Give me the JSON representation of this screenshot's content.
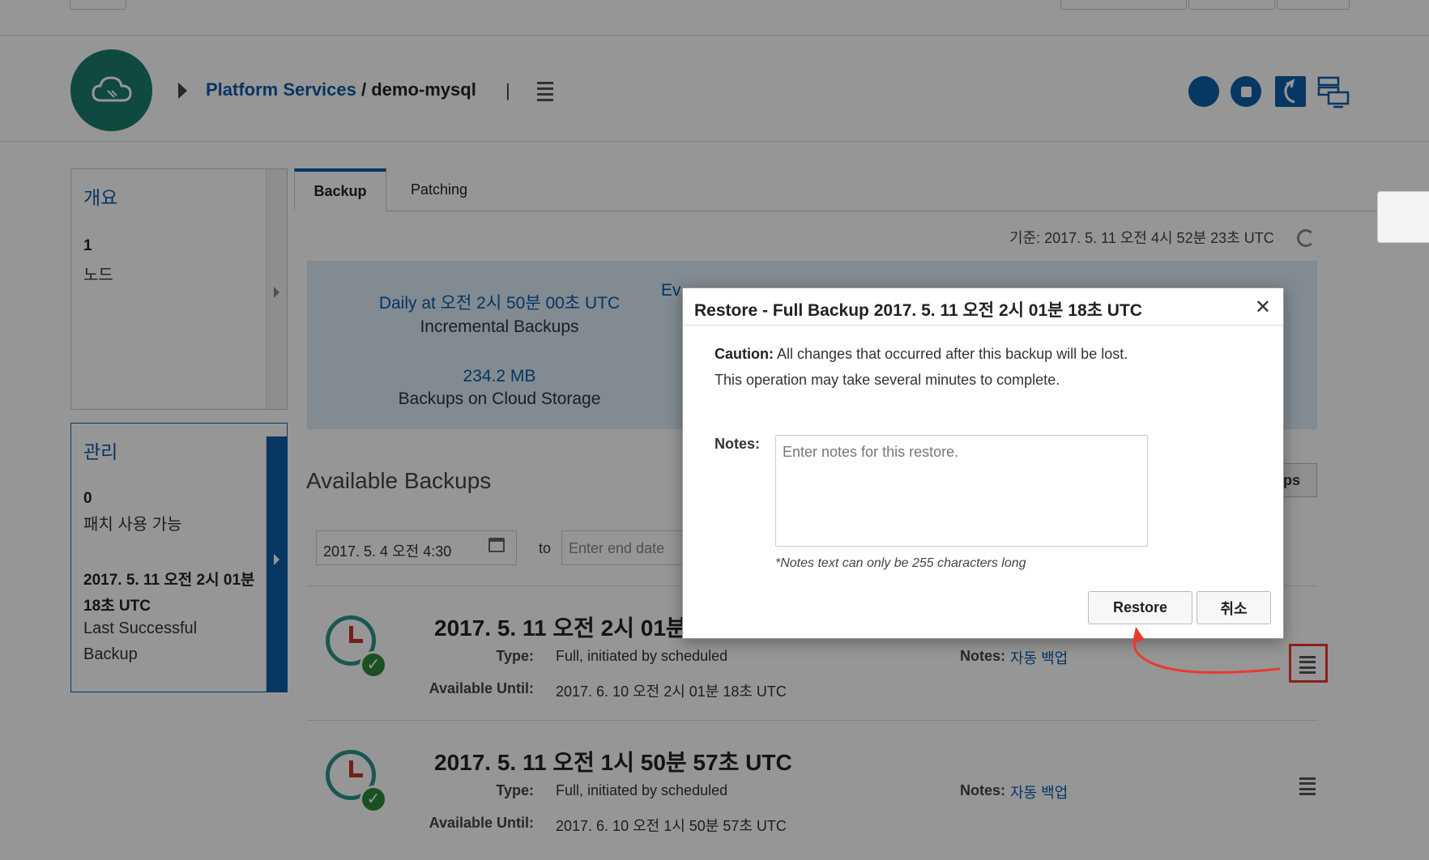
{
  "header": {
    "crumb_link": "Platform Services",
    "crumb_separator": " / ",
    "crumb_current": "demo-mysql",
    "crumb_bar": "|"
  },
  "sidebar": {
    "overview": {
      "title": "개요",
      "count": "1",
      "label": "노드"
    },
    "manage": {
      "title": "관리",
      "count": "0",
      "count_label": "패치 사용 가능",
      "last_backup_line1": "2017. 5. 11 오전 2시 01분",
      "last_backup_line2": "18초 UTC",
      "last_backup_label_line1": "Last Successful",
      "last_backup_label_line2": "Backup"
    }
  },
  "tabs": [
    {
      "label": "Backup",
      "active": true
    },
    {
      "label": "Patching",
      "active": false
    }
  ],
  "as_of": "기준: 2017. 5. 11 오전 4시 52분 23초 UTC",
  "summary": {
    "schedule_value": "Daily at 오전 2시 50분 00초 UTC",
    "schedule_label": "Incremental Backups",
    "storage_value": "234.2 MB",
    "storage_label": "Backups on Cloud Storage",
    "partial_text": "Ev"
  },
  "available": {
    "title": "Available Backups",
    "start_date": "2017. 5. 4 오전 4:30",
    "to_label": "to",
    "end_date_placeholder": "Enter end date",
    "right_button_partial": "ups"
  },
  "backups": [
    {
      "title": "2017. 5. 11 오전 2시 01분",
      "type_label": "Type:",
      "type": "Full, initiated by scheduled",
      "until_label": "Available Until:",
      "until": "2017. 6. 10 오전 2시 01분 18초 UTC",
      "notes_label": "Notes:",
      "notes": "자동 백업"
    },
    {
      "title": "2017. 5. 11 오전 1시 50분 57초 UTC",
      "type_label": "Type:",
      "type": "Full, initiated by scheduled",
      "until_label": "Available Until:",
      "until": "2017. 6. 10 오전 1시 50분 57초 UTC",
      "notes_label": "Notes:",
      "notes": "자동 백업"
    }
  ],
  "dialog": {
    "title": "Restore - Full Backup 2017. 5. 11 오전 2시 01분 18초 UTC",
    "close_glyph": "✕",
    "caution_label": "Caution:",
    "caution_text": " All changes that occurred after this backup will be lost.",
    "duration_text": "This operation may take several minutes to complete.",
    "notes_label": "Notes:",
    "notes_placeholder": "Enter notes for this restore.",
    "notes_hint": "*Notes text can only be 255 characters long",
    "restore_button": "Restore",
    "cancel_button": "취소"
  },
  "icons": {
    "logo": "cloud-icon",
    "header_buttons": [
      "start-icon",
      "stop-icon",
      "restart-icon",
      "instances-icon"
    ],
    "refresh": "refresh-icon",
    "calendar": "calendar-icon",
    "row_menu": "menu-icon",
    "backup_status": "backup-success-icon"
  },
  "colors": {
    "brand_blue": "#0d5ea8",
    "link_blue": "#0b5aa8",
    "logo_teal": "#1a7d6e",
    "summary_bg": "#dcecf7",
    "annotation_red": "#e83a2f",
    "success_green": "#2e8b3a"
  }
}
